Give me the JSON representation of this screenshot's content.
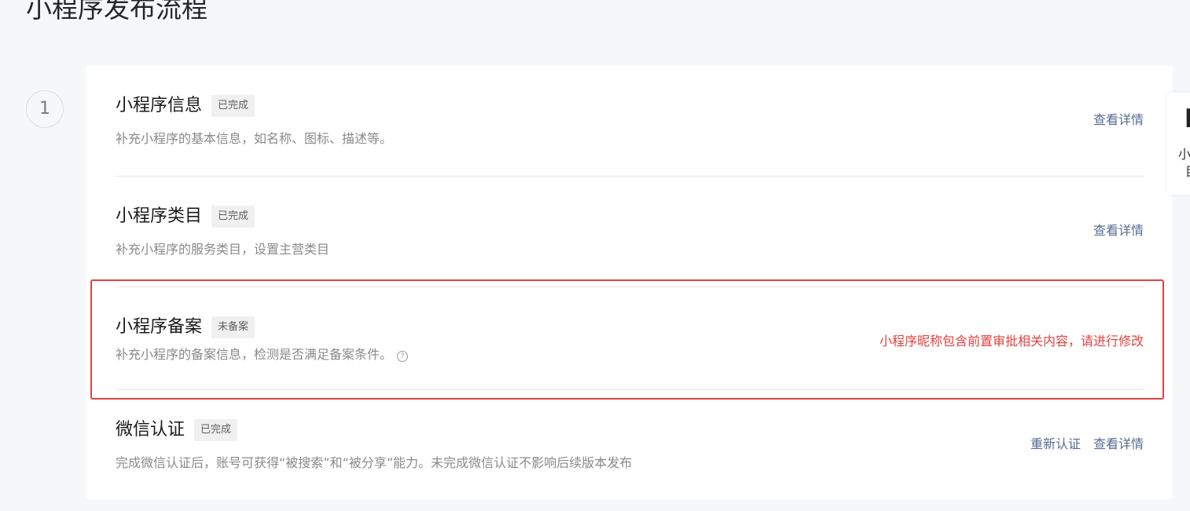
{
  "page": {
    "title": "小程序发布流程"
  },
  "step": {
    "number": "1"
  },
  "items": [
    {
      "title": "小程序信息",
      "badge": "已完成",
      "description": "补充小程序的基本信息，如名称、图标、描述等。",
      "actions": [
        "查看详情"
      ]
    },
    {
      "title": "小程序类目",
      "badge": "已完成",
      "description": "补充小程序的服务类目，设置主营类目",
      "actions": [
        "查看详情"
      ]
    },
    {
      "title": "小程序备案",
      "badge": "未备案",
      "description": "补充小程序的备案信息，检测是否满足备案条件。",
      "help_icon": "question-circle-icon",
      "warning": "小程序昵称包含前置审批相关内容，请进行修改"
    },
    {
      "title": "微信认证",
      "badge": "已完成",
      "description": "完成微信认证后，账号可获得“被搜索”和“被分享”能力。未完成微信认证不影响后续版本发布",
      "actions": [
        "重新认证",
        "查看详情"
      ]
    }
  ],
  "side_panel": {
    "line1": "小",
    "line2": "目"
  },
  "colors": {
    "link": "#576b95",
    "warning": "#e0433f",
    "highlight_border": "#e0433f"
  }
}
